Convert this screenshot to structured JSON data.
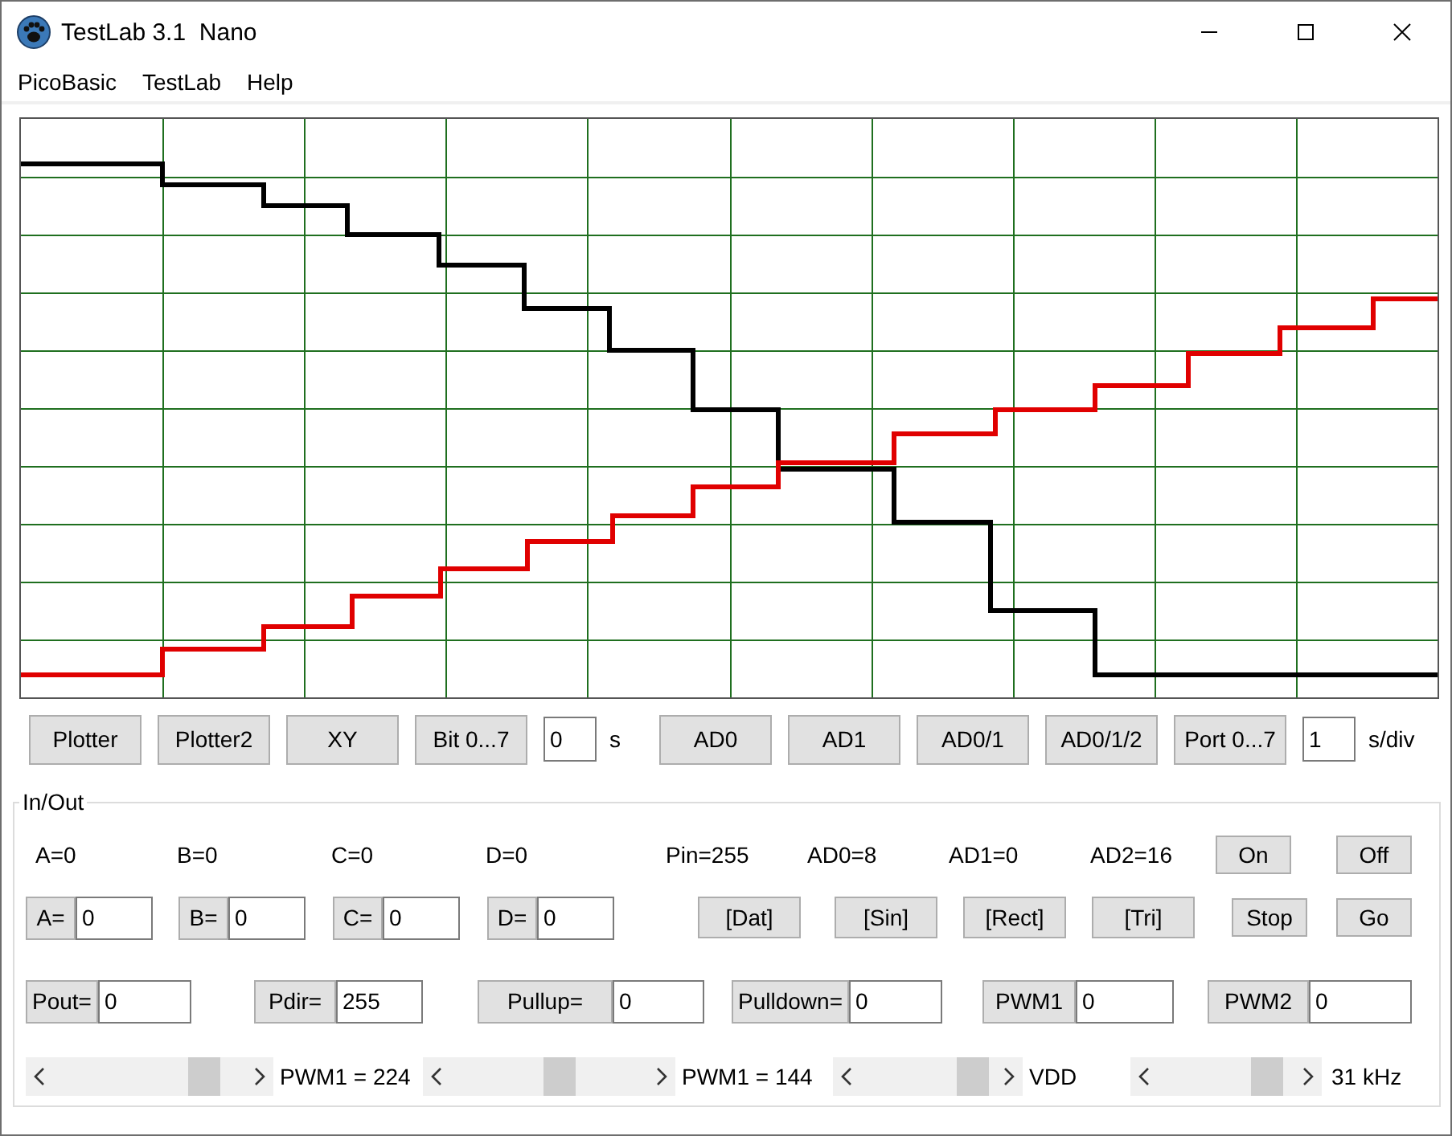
{
  "window": {
    "title": "TestLab 3.1  Nano"
  },
  "menu": [
    "PicoBasic",
    "TestLab",
    "Help"
  ],
  "toolbar": [
    {
      "kind": "button",
      "label": "Plotter"
    },
    {
      "kind": "button",
      "label": "Plotter2"
    },
    {
      "kind": "button",
      "label": "XY"
    },
    {
      "kind": "button",
      "label": "Bit 0...7"
    },
    {
      "kind": "field",
      "value": "0"
    },
    {
      "kind": "unit",
      "text": "s"
    },
    {
      "kind": "button",
      "label": "AD0"
    },
    {
      "kind": "button",
      "label": "AD1"
    },
    {
      "kind": "button",
      "label": "AD0/1"
    },
    {
      "kind": "button",
      "label": "AD0/1/2"
    },
    {
      "kind": "button",
      "label": "Port 0...7"
    },
    {
      "kind": "field",
      "value": "1"
    },
    {
      "kind": "unit",
      "text": "s/div"
    }
  ],
  "group": {
    "title": "In/Out",
    "readouts": [
      "A=0",
      "B=0",
      "C=0",
      "D=0",
      "Pin=255",
      "AD0=8",
      "AD1=0",
      "AD2=16"
    ],
    "power_buttons": [
      "On",
      "Off"
    ],
    "register_inputs": [
      {
        "label": "A=",
        "value": "0"
      },
      {
        "label": "B=",
        "value": "0"
      },
      {
        "label": "C=",
        "value": "0"
      },
      {
        "label": "D=",
        "value": "0"
      }
    ],
    "signal_buttons": [
      "[Dat]",
      "[Sin]",
      "[Rect]",
      "[Tri]",
      "Stop",
      "Go"
    ],
    "port_inputs": [
      {
        "label": "Pout=",
        "value": "0"
      },
      {
        "label": "Pdir=",
        "value": "255"
      },
      {
        "label": "Pullup=",
        "value": "0"
      },
      {
        "label": "Pulldown=",
        "value": "0"
      },
      {
        "label": "PWM1",
        "value": "0"
      },
      {
        "label": "PWM2",
        "value": "0"
      }
    ],
    "sliders": [
      {
        "reading": "PWM1 = 224"
      },
      {
        "reading": "PWM1 = 144"
      },
      {
        "reading": "VDD"
      },
      {
        "reading": "31 kHz"
      }
    ]
  }
}
